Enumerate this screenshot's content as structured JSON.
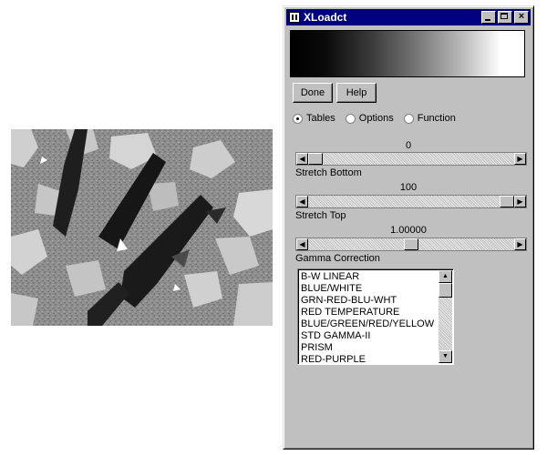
{
  "window": {
    "title": "XLoadct",
    "icon": "xloadct-app-icon",
    "minimize_icon": "minimize-icon",
    "maximize_icon": "maximize-icon",
    "close_icon": "close-icon",
    "close_glyph": "×"
  },
  "buttons": {
    "done": "Done",
    "help": "Help"
  },
  "mode_options": [
    {
      "label": "Tables",
      "selected": true
    },
    {
      "label": "Options",
      "selected": false
    },
    {
      "label": "Function",
      "selected": false
    }
  ],
  "sliders": {
    "stretch_bottom": {
      "value": "0",
      "label": "Stretch Bottom",
      "position_fraction": 0.0
    },
    "stretch_top": {
      "value": "100",
      "label": "Stretch Top",
      "position_fraction": 1.0
    },
    "gamma": {
      "value": "1.00000",
      "label": "Gamma Correction",
      "position_fraction": 0.5
    }
  },
  "color_tables": [
    "B-W LINEAR",
    "BLUE/WHITE",
    "GRN-RED-BLU-WHT",
    "RED TEMPERATURE",
    "BLUE/GREEN/RED/YELLOW",
    "STD GAMMA-II",
    "PRISM",
    "RED-PURPLE"
  ],
  "glyphs": {
    "left": "◀",
    "right": "▶",
    "up": "▲",
    "down": "▼"
  },
  "colors": {
    "title_bar": "#000080",
    "window_bg": "#c0c0c0"
  }
}
